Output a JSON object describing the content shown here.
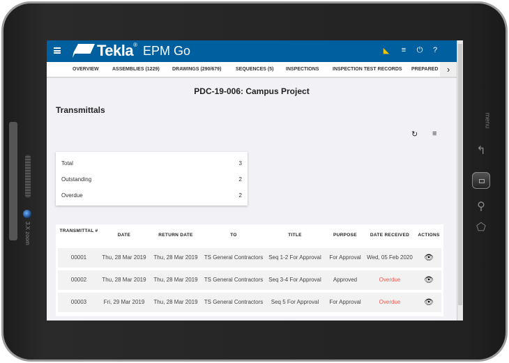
{
  "device": {
    "zoom_label": "3.X zoom",
    "menu_label": "menu"
  },
  "app": {
    "brand": "Tekla",
    "product": "EPM Go"
  },
  "tabs": [
    "OVERVIEW",
    "ASSEMBLIES (1229)",
    "DRAWINGS (290/679)",
    "SEQUENCES (5)",
    "INSPECTIONS",
    "INSPECTION TEST RECORDS",
    "PREPARED"
  ],
  "project_title": "PDC-19-006: Campus Project",
  "section_title": "Transmittals",
  "summary": [
    {
      "label": "Total",
      "value": "3"
    },
    {
      "label": "Outstanding",
      "value": "2"
    },
    {
      "label": "Overdue",
      "value": "2"
    }
  ],
  "table": {
    "headers": [
      "TRANSMITTAL #",
      "DATE",
      "RETURN DATE",
      "TO",
      "TITLE",
      "PURPOSE",
      "DATE RECEIVED",
      "ACTIONS"
    ],
    "rows": [
      {
        "no": "00001",
        "date": "Thu, 28 Mar 2019",
        "return": "Thu, 28 Mar 2019",
        "to": "TS General Contractors",
        "title": "Seq 1-2 For Approval",
        "purpose": "For Approval",
        "received": "Wed, 05 Feb 2020",
        "overdue": false
      },
      {
        "no": "00002",
        "date": "Thu, 28 Mar 2019",
        "return": "Thu, 28 Mar 2019",
        "to": "TS General Contractors",
        "title": "Seq 3-4 For Approval",
        "purpose": "Approved",
        "received": "Overdue",
        "overdue": true
      },
      {
        "no": "00003",
        "date": "Fri, 29 Mar 2019",
        "return": "Thu, 28 Mar 2019",
        "to": "TS General Contractors",
        "title": "Seq 5 For Approval",
        "purpose": "For Approval",
        "received": "Overdue",
        "overdue": true
      }
    ]
  },
  "colors": {
    "appbar": "#005f9e",
    "overdue": "#f05a4f"
  }
}
